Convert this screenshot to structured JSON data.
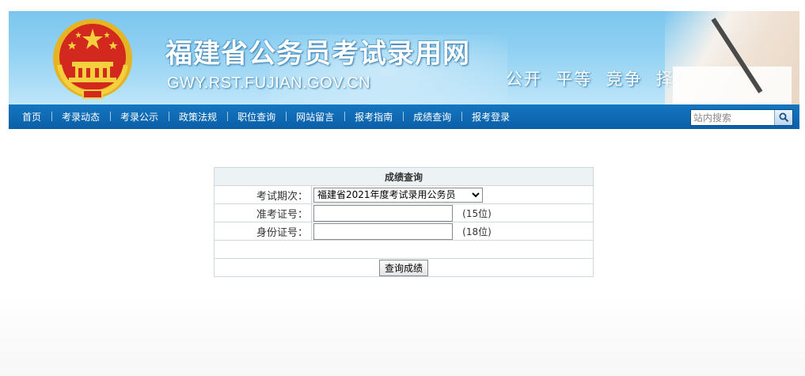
{
  "header": {
    "title": "福建省公务员考试录用网",
    "domain": "GWY.RST.FUJIAN.GOV.CN",
    "slogan": "公开  平等  竞争  择优"
  },
  "nav": {
    "items": [
      "首页",
      "考录动态",
      "考录公示",
      "政策法规",
      "职位查询",
      "网站留言",
      "报考指南",
      "成绩查询",
      "报考登录"
    ],
    "search_placeholder": "站内搜索"
  },
  "form": {
    "title": "成绩查询",
    "exam_label": "考试期次：",
    "exam_selected": "福建省2021年度考试录用公务员",
    "ticket_label": "准考证号：",
    "ticket_value": "",
    "ticket_hint": "(15位)",
    "id_label": "身份证号：",
    "id_value": "",
    "id_hint": "(18位)",
    "submit_label": "查询成绩"
  },
  "colors": {
    "nav_bg": "#0a5fa8",
    "banner_sky": "#8fd0f2",
    "table_border": "#cfd8dc",
    "table_head_bg": "#edf2f4"
  }
}
